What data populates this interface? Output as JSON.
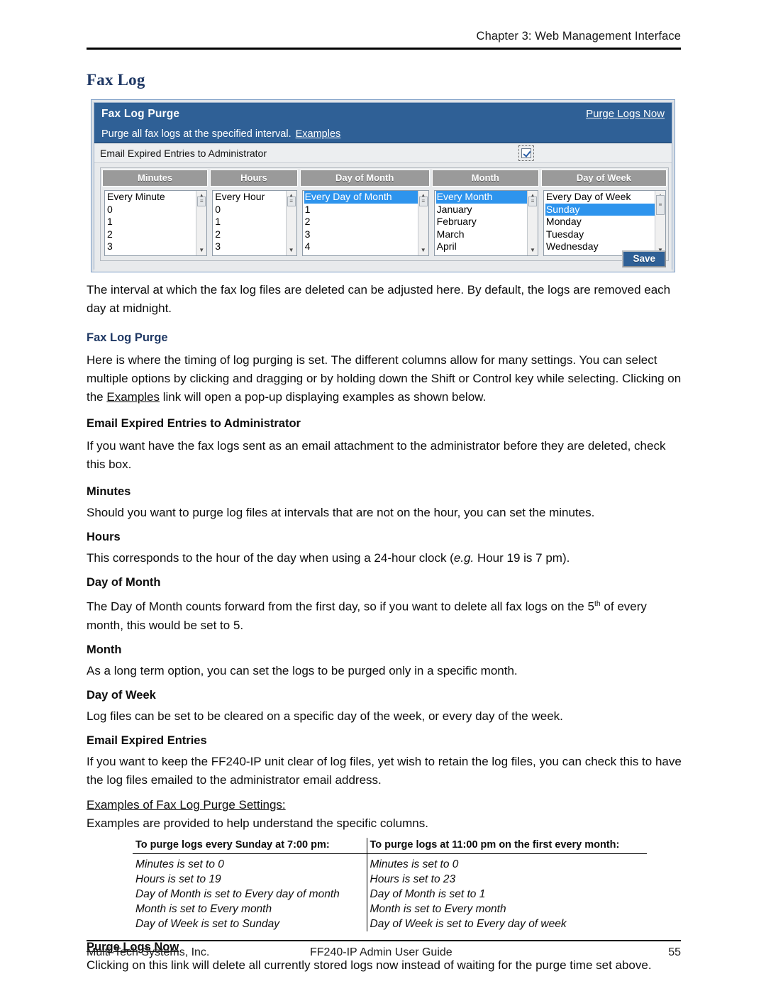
{
  "page": {
    "running_header": "Chapter 3: Web Management Interface",
    "title": "Fax Log",
    "footer_left": "Multi-Tech Systems, Inc.",
    "footer_center": "FF240-IP Admin User Guide",
    "footer_page_number": "55",
    "accent_heading_color": "#1f3864",
    "panel_blue": "#2f6096",
    "selection_blue": "#2e94ed"
  },
  "screenshot": {
    "title": "Fax Log Purge",
    "purge_logs_now_link": "Purge Logs Now",
    "subtitle": "Purge all fax logs at the specified interval.",
    "examples_link": "Examples",
    "email_expired_label": "Email Expired Entries to Administrator",
    "checkbox_checked": true,
    "save_button": "Save",
    "columns": [
      {
        "header": "Minutes",
        "items": [
          "Every Minute",
          "0",
          "1",
          "2",
          "3"
        ],
        "selected_index": -1
      },
      {
        "header": "Hours",
        "items": [
          "Every Hour",
          "0",
          "1",
          "2",
          "3"
        ],
        "selected_index": -1
      },
      {
        "header": "Day of Month",
        "items": [
          "Every Day of Month",
          "1",
          "2",
          "3",
          "4"
        ],
        "selected_index": 0
      },
      {
        "header": "Month",
        "items": [
          "Every Month",
          "January",
          "February",
          "March",
          "April"
        ],
        "selected_index": 0
      },
      {
        "header": "Day of Week",
        "items": [
          "Every Day of Week",
          "Sunday",
          "Monday",
          "Tuesday",
          "Wednesday"
        ],
        "selected_index": 1
      }
    ]
  },
  "body": {
    "intro": "The interval at which the fax log files are deleted can be adjusted here. By default, the logs are removed each day at midnight.",
    "fax_log_purge_heading": "Fax Log Purge",
    "fax_log_purge_p1": "Here is where the timing of log purging is set. The different columns allow for many settings. You can select multiple options by clicking and dragging or by holding down the Shift or Control key while selecting. Clicking on the ",
    "fax_log_purge_examples_link": "Examples",
    "fax_log_purge_p2": " link will open a pop-up displaying examples as shown below.",
    "email_expired_admin_heading": "Email Expired Entries to Administrator",
    "email_expired_admin_text": "If you want have the fax logs sent as an email attachment to the administrator before they are deleted, check this box.",
    "minutes_heading": "Minutes",
    "minutes_text": "Should you want to purge log files at intervals that are not on the hour, you can set the minutes.",
    "hours_heading": "Hours",
    "hours_text_a": "This corresponds to the hour of the day when using a 24-hour clock (",
    "hours_text_em": "e.g.",
    "hours_text_b": " Hour 19 is 7 pm).",
    "day_of_month_heading": "Day of Month",
    "day_of_month_text_a": "The Day of Month counts forward from the first day, so if you want to delete all fax logs on the 5",
    "day_of_month_sup": "th",
    "day_of_month_text_b": " of every month, this would be set to 5.",
    "month_heading": "Month",
    "month_text": "As a long term option, you can set the logs to be purged only in a specific month.",
    "day_of_week_heading": "Day of Week",
    "day_of_week_text": "Log files can be set to be cleared on a specific day of the week, or every day of the week.",
    "email_expired_heading": "Email Expired Entries",
    "email_expired_text": "If you want to keep the FF240-IP unit clear of log files, yet wish to retain the log files, you can check this to have the log files emailed to the administrator email address.",
    "examples_settings_heading": "Examples of Fax Log Purge Settings:",
    "examples_settings_text": "Examples are provided to help understand the specific columns.",
    "purge_logs_now_heading": "Purge Logs Now",
    "purge_logs_now_text": "Clicking on this link will delete all currently stored logs now instead of waiting for the purge time set above."
  },
  "examples_table": {
    "headers": [
      "To purge logs every Sunday at 7:00 pm:",
      "To purge logs at 11:00 pm on the first every month:"
    ],
    "rows": [
      [
        "Minutes is set to 0",
        "Minutes is set to 0"
      ],
      [
        "Hours is set to 19",
        "Hours is set to 23"
      ],
      [
        "Day of Month is set to Every day of month",
        "Day of Month is set to 1"
      ],
      [
        "Month is set to Every month",
        "Month is set to Every month"
      ],
      [
        "Day of Week is set to Sunday",
        "Day of Week is set to Every day of week"
      ]
    ]
  }
}
